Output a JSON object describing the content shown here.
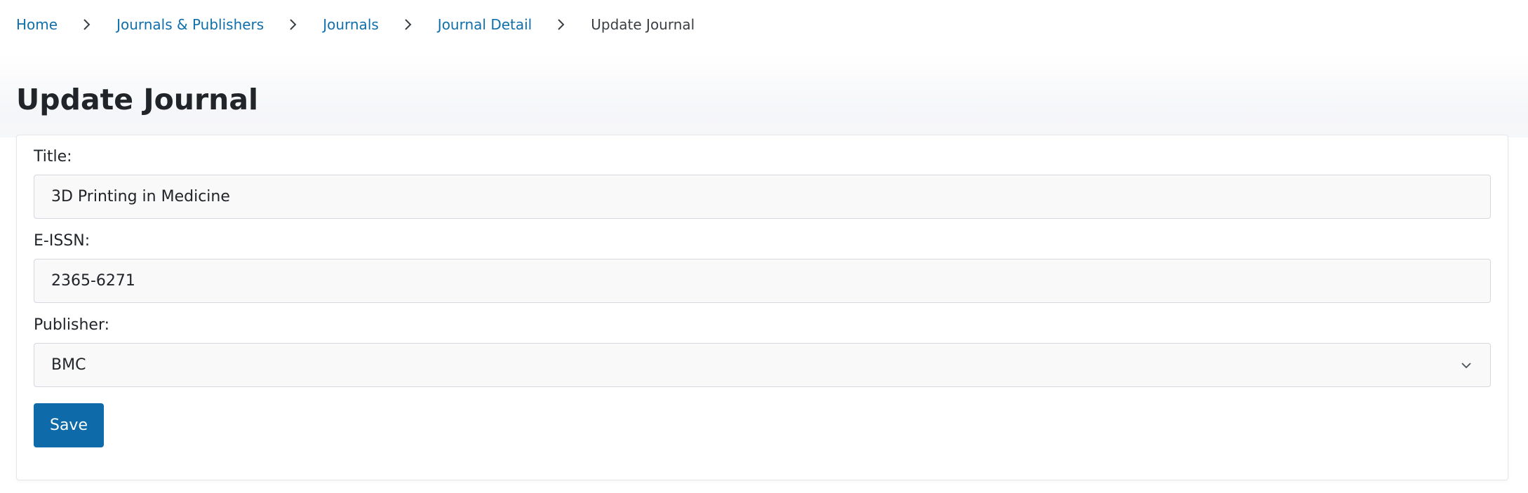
{
  "breadcrumb": {
    "items": [
      {
        "label": "Home",
        "link": true
      },
      {
        "label": "Journals & Publishers",
        "link": true
      },
      {
        "label": "Journals",
        "link": true
      },
      {
        "label": "Journal Detail",
        "link": true
      },
      {
        "label": "Update Journal",
        "link": false
      }
    ],
    "separator_icon": "chevron-right-icon"
  },
  "page": {
    "title": "Update Journal"
  },
  "form": {
    "title": {
      "label": "Title:",
      "value": "3D Printing in Medicine"
    },
    "eissn": {
      "label": "E-ISSN:",
      "value": "2365-6271"
    },
    "publisher": {
      "label": "Publisher:",
      "selected": "BMC",
      "icon": "chevron-down-icon"
    },
    "save_label": "Save"
  },
  "colors": {
    "link": "#0f6fab",
    "primary_button": "#0e6aa8",
    "input_background": "#f9f9fa",
    "input_border": "#d5d8dc"
  }
}
